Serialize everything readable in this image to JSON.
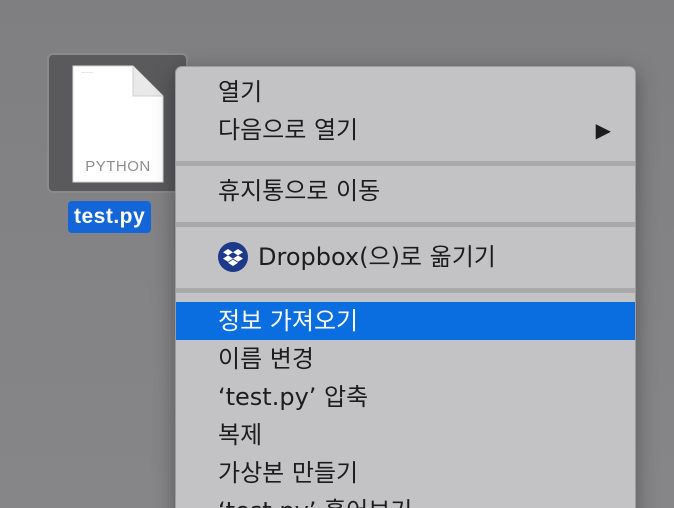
{
  "desktop": {
    "file": {
      "name": "test.py",
      "type_label": "PYTHON",
      "selection_color": "#1466d8"
    }
  },
  "context_menu": {
    "items": [
      {
        "label": "열기"
      },
      {
        "label": "다음으로 열기",
        "submenu_arrow": "▶"
      },
      {
        "label": "휴지통으로 이동"
      },
      {
        "label": "Dropbox(으)로 옮기기",
        "icon": "dropbox-icon"
      },
      {
        "label": "정보 가져오기",
        "highlighted": true
      },
      {
        "label": "이름 변경"
      },
      {
        "label": "‘test.py’ 압축"
      },
      {
        "label": "복제"
      },
      {
        "label": "가상본 만들기"
      },
      {
        "label": "‘test.py’ 훑어보기"
      }
    ],
    "highlight_color": "#0a6ee0"
  }
}
